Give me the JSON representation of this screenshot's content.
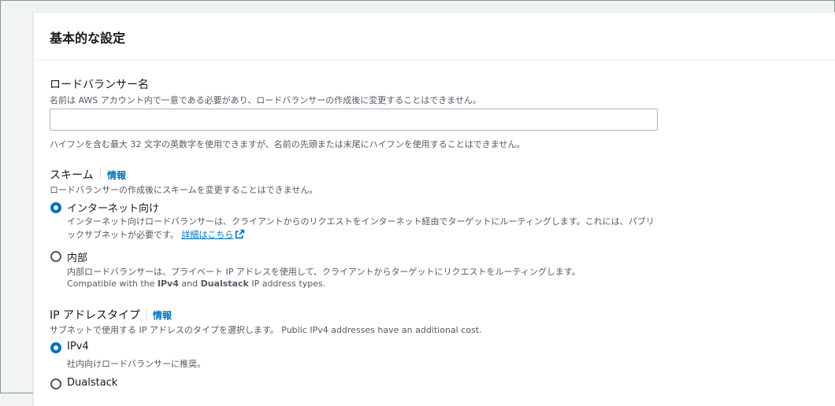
{
  "section": {
    "title": "基本的な設定"
  },
  "lb_name": {
    "label": "ロードバランサー名",
    "description": "名前は AWS アカウント内で一意である必要があり、ロードバランサーの作成後に変更することはできません。",
    "value": "",
    "placeholder": "",
    "hint": "ハイフンを含む最大 32 文字の英数字を使用できますが、名前の先頭または末尾にハイフンを使用することはできません。"
  },
  "scheme": {
    "label": "スキーム",
    "info_link": "情報",
    "description": "ロードバランサーの作成後にスキームを変更することはできません。",
    "options": [
      {
        "label": "インターネット向け",
        "selected": true,
        "description": "インターネット向けロードバランサーは、クライアントからのリクエストをインターネット経由でターゲットにルーティングします。これには、パブリックサブネットが必要です。",
        "link": "詳細はこちら"
      },
      {
        "label": "内部",
        "selected": false,
        "description": "内部ロードバランサーは、プライベート IP アドレスを使用して、クライアントからターゲットにリクエストをルーティングします。",
        "compat_prefix": "Compatible with the ",
        "compat_ipv4": "IPv4",
        "compat_and": " and ",
        "compat_dualstack": "Dualstack",
        "compat_suffix": " IP address types."
      }
    ]
  },
  "ip_type": {
    "label": "IP アドレスタイプ",
    "info_link": "情報",
    "description": "サブネットで使用する IP アドレスのタイプを選択します。 Public IPv4 addresses have an additional cost.",
    "options": [
      {
        "label": "IPv4",
        "selected": true,
        "description": "社内向けロードバランサーに推奨。"
      },
      {
        "label": "Dualstack",
        "selected": false
      }
    ]
  },
  "colors": {
    "accent": "#0073bb",
    "text": "#16191f",
    "muted": "#545b64",
    "border": "#aab7b8"
  },
  "icons": {
    "external_link": "external-link-icon"
  }
}
